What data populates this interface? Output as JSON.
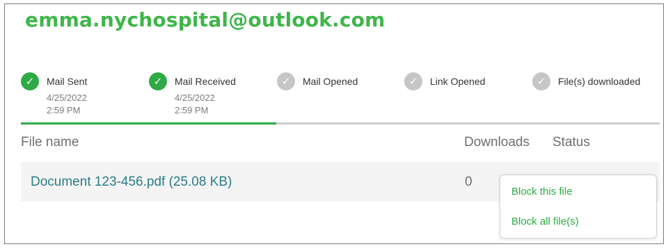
{
  "header": {
    "email": "emma.nychospital@outlook.com"
  },
  "colors": {
    "accent_green": "#2daa44",
    "title_green": "#3fb54a",
    "link_teal": "#2a7b86",
    "inactive_gray": "#c6c6c6"
  },
  "steps": [
    {
      "label": "Mail Sent",
      "status": "done",
      "icon": "check-icon",
      "date": "4/25/2022",
      "time": "2:59 PM"
    },
    {
      "label": "Mail Received",
      "status": "done",
      "icon": "check-icon",
      "date": "4/25/2022",
      "time": "2:59 PM"
    },
    {
      "label": "Mail Opened",
      "status": "pending",
      "icon": "check-icon",
      "date": "",
      "time": ""
    },
    {
      "label": "Link Opened",
      "status": "pending",
      "icon": "check-icon",
      "date": "",
      "time": ""
    },
    {
      "label": "File(s) downloaded",
      "status": "pending",
      "icon": "check-icon",
      "date": "",
      "time": ""
    }
  ],
  "progress": {
    "fraction": 0.4
  },
  "table": {
    "headers": {
      "file_name": "File name",
      "downloads": "Downloads",
      "status": "Status"
    },
    "rows": [
      {
        "file": "Document 123-456.pdf (25.08 KB)",
        "downloads": "0"
      }
    ]
  },
  "status_menu": {
    "items": [
      "Block this file",
      "Block all file(s)"
    ]
  }
}
